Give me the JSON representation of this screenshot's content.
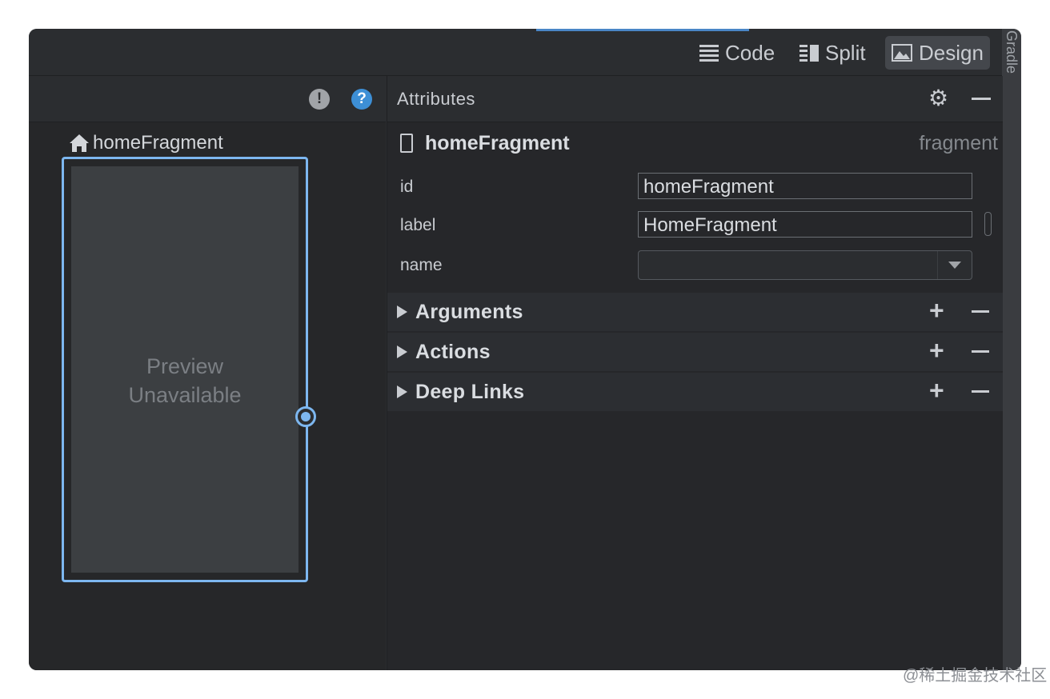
{
  "toolbar": {
    "modes": [
      {
        "label": "Code",
        "icon": "lines-icon",
        "active": false
      },
      {
        "label": "Split",
        "icon": "split-icon",
        "active": false
      },
      {
        "label": "Design",
        "icon": "image-icon",
        "active": true
      }
    ]
  },
  "side_strip": {
    "label": "Gradle"
  },
  "canvas": {
    "warning_glyph": "!",
    "help_glyph": "?",
    "destination_label": "homeFragment",
    "preview_line1": "Preview",
    "preview_line2": "Unavailable"
  },
  "attributes": {
    "title": "Attributes",
    "component_name": "homeFragment",
    "component_type": "fragment",
    "fields": [
      {
        "label": "id",
        "value": "homeFragment"
      },
      {
        "label": "label",
        "value": "HomeFragment"
      },
      {
        "label": "name",
        "value": ""
      }
    ],
    "sections": [
      {
        "label": "Arguments"
      },
      {
        "label": "Actions"
      },
      {
        "label": "Deep Links"
      }
    ]
  },
  "watermark": "@稀土掘金技术社区",
  "colors": {
    "accent": "#7db7f0",
    "help": "#3d8fd6",
    "background": "#2b2d30"
  }
}
